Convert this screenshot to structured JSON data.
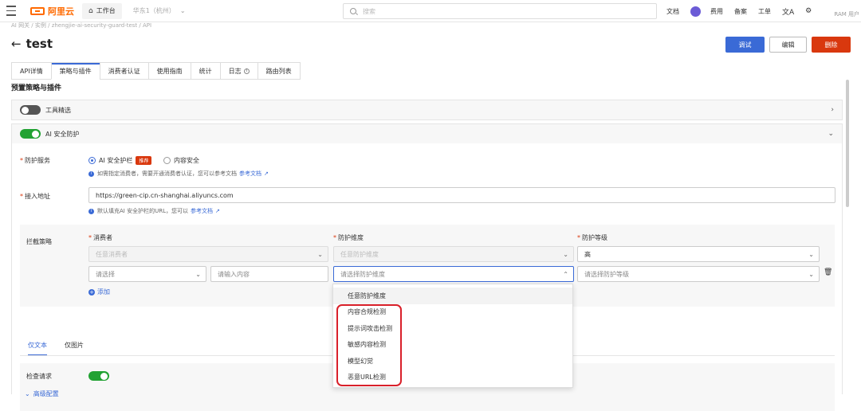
{
  "topbar": {
    "brand": "阿里云",
    "workbench": "工作台",
    "region": "华东1（杭州）",
    "search_placeholder": "搜索",
    "nav": [
      "文档",
      "费用",
      "备案",
      "工单"
    ],
    "account": "RAM 用户"
  },
  "breadcrumb": "AI 网关 / 实例 / zhengjie-ai-security-guard-test / API",
  "page": {
    "title": "test",
    "buttons": {
      "debug": "调试",
      "edit": "编辑",
      "delete": "删除"
    }
  },
  "tabs": [
    {
      "label": "API详情",
      "active": false
    },
    {
      "label": "策略与插件",
      "active": true
    },
    {
      "label": "消费者认证",
      "active": false
    },
    {
      "label": "使用指南",
      "active": false
    },
    {
      "label": "统计",
      "active": false
    },
    {
      "label": "日志",
      "active": false
    },
    {
      "label": "路由列表",
      "active": false
    }
  ],
  "section_title": "预置策略与插件",
  "panels": {
    "tools": {
      "label": "工具精选",
      "enabled": false
    },
    "ai_security": {
      "label": "AI 安全防护",
      "enabled": true
    }
  },
  "protection_service": {
    "label": "防护服务",
    "options": [
      {
        "label": "AI 安全护栏",
        "badge": "推荐",
        "selected": true
      },
      {
        "label": "内容安全",
        "selected": false
      }
    ],
    "hint": "如需指定消费者，需要开通消费者认证，您可以参考文档",
    "hint_link": "参考文档"
  },
  "endpoint": {
    "label": "接入地址",
    "value": "https://green-cip.cn-shanghai.aliyuncs.com",
    "hint": "默认填充AI 安全护栏的URL，您可以",
    "hint_link": "参考文档"
  },
  "interception": {
    "label": "拦截策略",
    "columns": [
      "消费者",
      "防护维度",
      "防护等级"
    ],
    "row_default": {
      "consumer": "任意消费者",
      "dimension": "任意防护维度",
      "level": "高"
    },
    "row_new": {
      "consumer_placeholder": "请选择",
      "content_placeholder": "请输入内容",
      "dimension_placeholder": "请选择防护维度",
      "level_placeholder": "请选择防护等级"
    },
    "add_label": "添加"
  },
  "subtabs": [
    {
      "label": "仅文本",
      "active": true
    },
    {
      "label": "仅图片",
      "active": false
    }
  ],
  "check_request": {
    "label": "检查请求",
    "enabled": true
  },
  "advanced": "高级配置",
  "dropdown_options": [
    "任意防护维度",
    "内容合规检测",
    "提示词攻击检测",
    "敏感内容检测",
    "模型幻觉",
    "恶意URL检测"
  ],
  "colors": {
    "primary": "#3a6ad6",
    "danger": "#d9380e",
    "toggle_on": "#22a233",
    "brand": "#ff6a00",
    "highlight": "#d9202a"
  }
}
